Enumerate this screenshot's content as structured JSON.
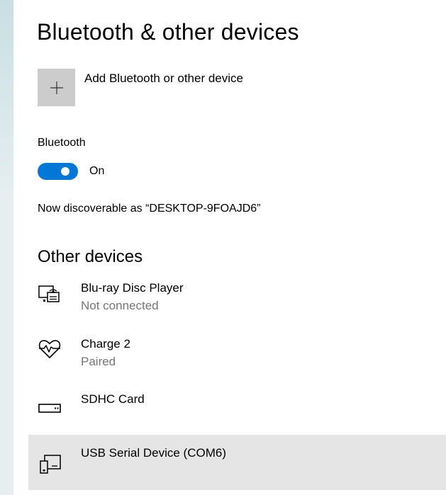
{
  "header": {
    "title": "Bluetooth & other devices"
  },
  "add_device": {
    "icon": "plus-icon",
    "label": "Add Bluetooth or other device"
  },
  "bluetooth": {
    "heading": "Bluetooth",
    "toggle_state": "On",
    "toggle_on": true,
    "accent_color": "#0078d7",
    "discoverable_text": "Now discoverable as “DESKTOP-9FOAJD6”"
  },
  "other_devices": {
    "title": "Other devices",
    "items": [
      {
        "name": "Blu-ray Disc Player",
        "status": "Not connected",
        "icon": "media-player-icon",
        "selected": false
      },
      {
        "name": "Charge 2",
        "status": "Paired",
        "icon": "heart-rate-icon",
        "selected": false
      },
      {
        "name": "SDHC Card",
        "status": "",
        "icon": "memory-card-icon",
        "selected": false
      },
      {
        "name": "USB Serial Device (COM6)",
        "status": "",
        "icon": "serial-device-icon",
        "selected": true
      }
    ]
  },
  "colors": {
    "selected_row_bg": "#e5e5e5",
    "secondary_text": "#767676",
    "add_tile_bg": "#cccccc"
  }
}
